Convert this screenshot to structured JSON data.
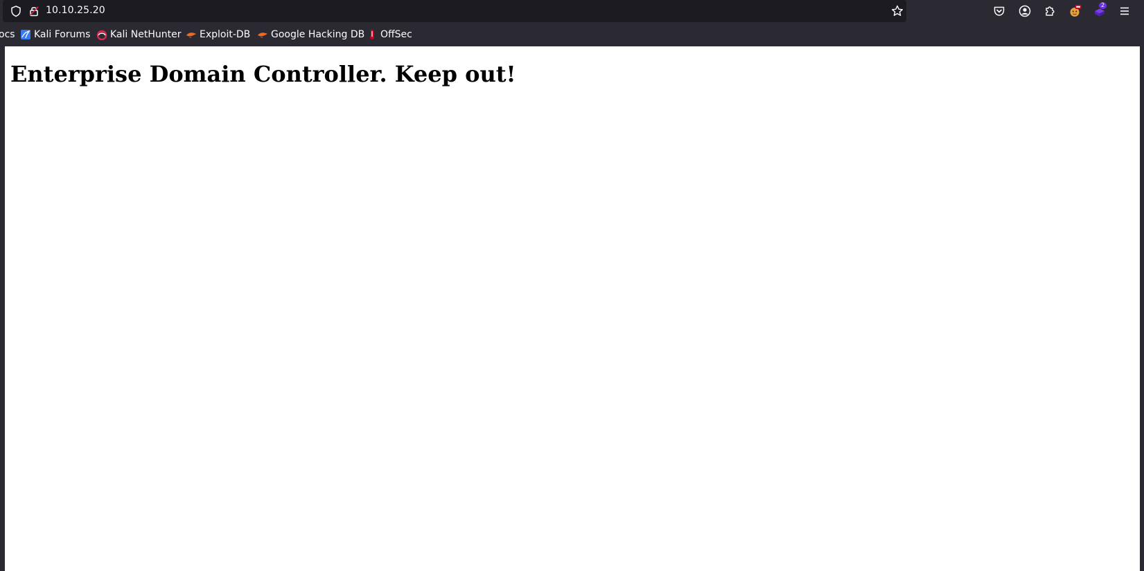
{
  "browser": {
    "url": "10.10.25.20",
    "toolbar_icons": [
      "shield-icon",
      "lock-icon",
      "star-icon",
      "pocket-icon",
      "account-icon",
      "extensions-icon",
      "extension-badge-icon",
      "extension-purple-icon",
      "menu-icon"
    ],
    "extension_badge_count": "2"
  },
  "bookmarks": [
    {
      "label": "ocs",
      "icon": "none"
    },
    {
      "label": "Kali Forums",
      "icon": "kali-forums-icon"
    },
    {
      "label": "Kali NetHunter",
      "icon": "kali-nethunter-icon"
    },
    {
      "label": "Exploit-DB",
      "icon": "exploit-db-icon"
    },
    {
      "label": "Google Hacking DB",
      "icon": "google-hacking-db-icon"
    },
    {
      "label": "OffSec",
      "icon": "offsec-icon"
    }
  ],
  "page": {
    "heading": "Enterprise Domain Controller. Keep out!"
  },
  "colors": {
    "chrome_bg": "#2b2a33",
    "urlbar_bg": "#1c1b22",
    "text_light": "#fbfbfe",
    "page_bg": "#ffffff",
    "heading_color": "#000000"
  }
}
